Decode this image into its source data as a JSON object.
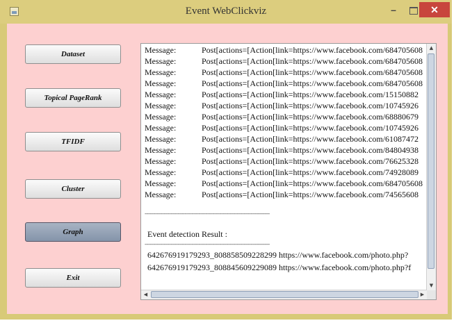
{
  "window": {
    "title": "Event WebClickviz",
    "minimize_label": "–",
    "close_label": "✕"
  },
  "sidebar": {
    "buttons": [
      {
        "label": "Dataset"
      },
      {
        "label": "Topical PageRank"
      },
      {
        "label": "TFIDF"
      },
      {
        "label": "Cluster"
      },
      {
        "label": "Graph"
      },
      {
        "label": "Exit"
      }
    ]
  },
  "output": {
    "messages": [
      {
        "label": "Message:",
        "text": "Post[actions=[Action[link=https://www.facebook.com/684705608"
      },
      {
        "label": "Message:",
        "text": "Post[actions=[Action[link=https://www.facebook.com/684705608"
      },
      {
        "label": "Message:",
        "text": "Post[actions=[Action[link=https://www.facebook.com/684705608"
      },
      {
        "label": "Message:",
        "text": "Post[actions=[Action[link=https://www.facebook.com/684705608"
      },
      {
        "label": "Message:",
        "text": "Post[actions=[Action[link=https://www.facebook.com/15150882"
      },
      {
        "label": "Message:",
        "text": "Post[actions=[Action[link=https://www.facebook.com/10745926"
      },
      {
        "label": "Message:",
        "text": "Post[actions=[Action[link=https://www.facebook.com/68880679"
      },
      {
        "label": "Message:",
        "text": "Post[actions=[Action[link=https://www.facebook.com/10745926"
      },
      {
        "label": "Message:",
        "text": "Post[actions=[Action[link=https://www.facebook.com/61087472"
      },
      {
        "label": "Message:",
        "text": "Post[actions=[Action[link=https://www.facebook.com/84804938"
      },
      {
        "label": "Message:",
        "text": "Post[actions=[Action[link=https://www.facebook.com/76625328"
      },
      {
        "label": "Message:",
        "text": "Post[actions=[Action[link=https://www.facebook.com/74928089"
      },
      {
        "label": "Message:",
        "text": "Post[actions=[Action[link=https://www.facebook.com/684705608"
      },
      {
        "label": "Message:",
        "text": "Post[actions=[Action[link=https://www.facebook.com/74565608"
      }
    ],
    "separator": "------------------------------------------------------------------------",
    "result_heading": "Event detection Result :",
    "results": [
      " 642676919179293_808858509228299  https://www.facebook.com/photo.php?",
      "642676919179293_808845609229089  https://www.facebook.com/photo.php?f"
    ]
  }
}
